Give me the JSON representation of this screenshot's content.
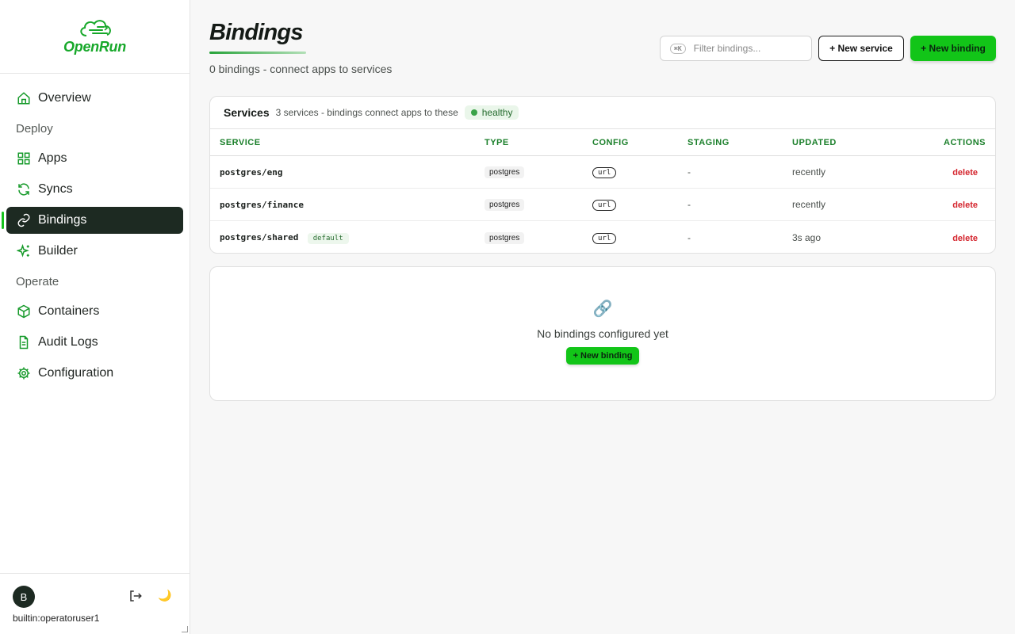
{
  "brand": {
    "name": "OpenRun"
  },
  "sidebar": {
    "items": [
      {
        "label": "Overview",
        "icon": "home-icon"
      },
      {
        "section": "Deploy"
      },
      {
        "label": "Apps",
        "icon": "grid-icon"
      },
      {
        "label": "Syncs",
        "icon": "refresh-icon"
      },
      {
        "label": "Bindings",
        "icon": "link-icon",
        "active": true
      },
      {
        "label": "Builder",
        "icon": "sparkle-icon"
      },
      {
        "section": "Operate"
      },
      {
        "label": "Containers",
        "icon": "box-icon"
      },
      {
        "label": "Audit Logs",
        "icon": "document-icon"
      },
      {
        "label": "Configuration",
        "icon": "gear-icon"
      }
    ],
    "labels": {
      "overview": "Overview",
      "deploy": "Deploy",
      "apps": "Apps",
      "syncs": "Syncs",
      "bindings": "Bindings",
      "builder": "Builder",
      "operate": "Operate",
      "containers": "Containers",
      "audit_logs": "Audit Logs",
      "configuration": "Configuration"
    },
    "user": {
      "initial": "B",
      "name": "builtin:operatoruser1"
    }
  },
  "header": {
    "title": "Bindings",
    "subtitle": "0 bindings - connect apps to services",
    "filter_shortcut": "⌘K",
    "filter_placeholder": "Filter bindings...",
    "new_service_label": "+ New service",
    "new_binding_label": "+ New binding"
  },
  "services": {
    "title": "Services",
    "meta": "3 services - bindings connect apps to these",
    "status": "healthy",
    "columns": [
      "SERVICE",
      "TYPE",
      "CONFIG",
      "STAGING",
      "UPDATED",
      "ACTIONS"
    ],
    "rows": [
      {
        "service": "postgres/eng",
        "badge": "",
        "type": "postgres",
        "config": "url",
        "staging": "-",
        "updated": "recently",
        "action": "delete"
      },
      {
        "service": "postgres/finance",
        "badge": "",
        "type": "postgres",
        "config": "url",
        "staging": "-",
        "updated": "recently",
        "action": "delete"
      },
      {
        "service": "postgres/shared",
        "badge": "default",
        "type": "postgres",
        "config": "url",
        "staging": "-",
        "updated": "3s ago",
        "action": "delete"
      }
    ]
  },
  "empty_state": {
    "icon": "link-icon",
    "text": "No bindings configured yet",
    "button_label": "+ New binding"
  },
  "colors": {
    "accent": "#12c518",
    "sidebar_active": "#1d2a22",
    "danger": "#d4242d",
    "heading_green": "#1a7f2a"
  }
}
